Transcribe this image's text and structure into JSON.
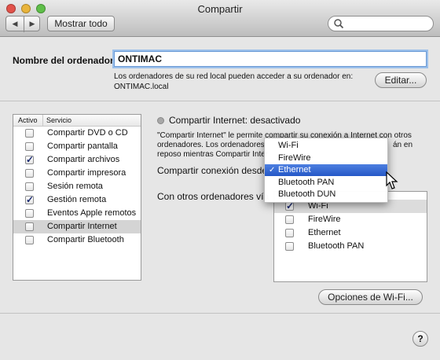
{
  "window": {
    "title": "Compartir"
  },
  "toolbar": {
    "back_glyph": "◀",
    "forward_glyph": "▶",
    "show_all": "Mostrar todo",
    "search_placeholder": ""
  },
  "computer": {
    "label": "Nombre del ordenador:",
    "name": "ONTIMAC",
    "description_line1": "Los ordenadores de su red local pueden acceder a su ordenador en:",
    "description_line2": "ONTIMAC.local",
    "edit_button": "Editar..."
  },
  "services": {
    "header_active": "Activo",
    "header_service": "Servicio",
    "items": [
      {
        "label": "Compartir DVD o CD",
        "checked": false
      },
      {
        "label": "Compartir pantalla",
        "checked": false
      },
      {
        "label": "Compartir archivos",
        "checked": true
      },
      {
        "label": "Compartir impresora",
        "checked": false
      },
      {
        "label": "Sesión remota",
        "checked": false
      },
      {
        "label": "Gestión remota",
        "checked": true
      },
      {
        "label": "Eventos Apple remotos",
        "checked": false
      },
      {
        "label": "Compartir Internet",
        "checked": false,
        "selected": true
      },
      {
        "label": "Compartir Bluetooth",
        "checked": false
      }
    ]
  },
  "internet": {
    "status": "Compartir Internet: desactivado",
    "desc_line1": "\"Compartir Internet\" le permite compartir su conexión a Internet con otros",
    "desc_line2": "ordenadores. Los ordenadores",
    "desc_line2_tail": "án en",
    "desc_line3": "reposo mientras Compartir Inter",
    "share_from_label": "Compartir conexión desde",
    "to_label": "Con otros ordenadores vía",
    "ports": [
      {
        "label": "Wi-Fi",
        "checked": true
      },
      {
        "label": "FireWire",
        "checked": false
      },
      {
        "label": "Ethernet",
        "checked": false
      },
      {
        "label": "Bluetooth PAN",
        "checked": false
      }
    ],
    "wifi_options_button": "Opciones de Wi-Fi..."
  },
  "popup_menu": {
    "items": [
      "Wi-Fi",
      "FireWire",
      "Ethernet",
      "Bluetooth PAN",
      "Bluetooth DUN"
    ],
    "selected": "Ethernet",
    "check_glyph": "✓"
  },
  "help": {
    "glyph": "?"
  },
  "colors": {
    "menu_selection": "#2f63d3",
    "close": "#e2524a",
    "minimize": "#e9b43b",
    "zoom": "#5fbf49",
    "check": "#1a2a70"
  }
}
